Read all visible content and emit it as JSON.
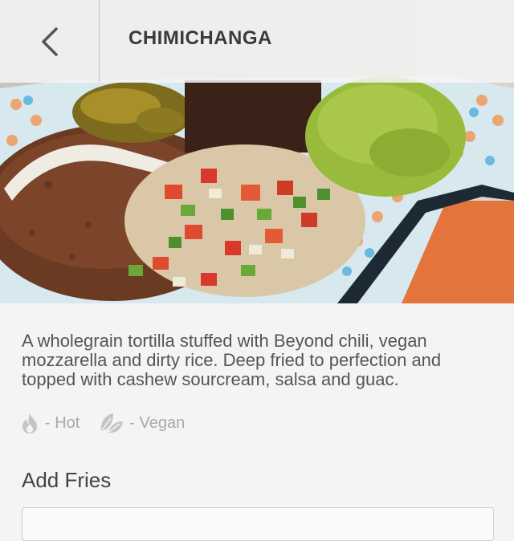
{
  "header": {
    "title": "CHIMICHANGA",
    "back_icon": "chevron-left-icon"
  },
  "hero": {
    "image": "chimichanga-photo"
  },
  "item": {
    "description": "A wholegrain tortilla stuffed with Beyond chili, vegan mozzarella and dirty rice. Deep fried to perfection and topped with cashew sourcream, salsa and guac.",
    "diet_tags": [
      {
        "icon": "flame-icon",
        "label": "- Hot"
      },
      {
        "icon": "leaf-icon",
        "label": "- Vegan"
      }
    ]
  },
  "options": {
    "add_fries_title": "Add Fries"
  },
  "colors": {
    "header_bg": "#f5f5f5",
    "title_text": "#3a3a3a",
    "body_text": "#555555",
    "tag_icon": "#bdbdbd"
  }
}
